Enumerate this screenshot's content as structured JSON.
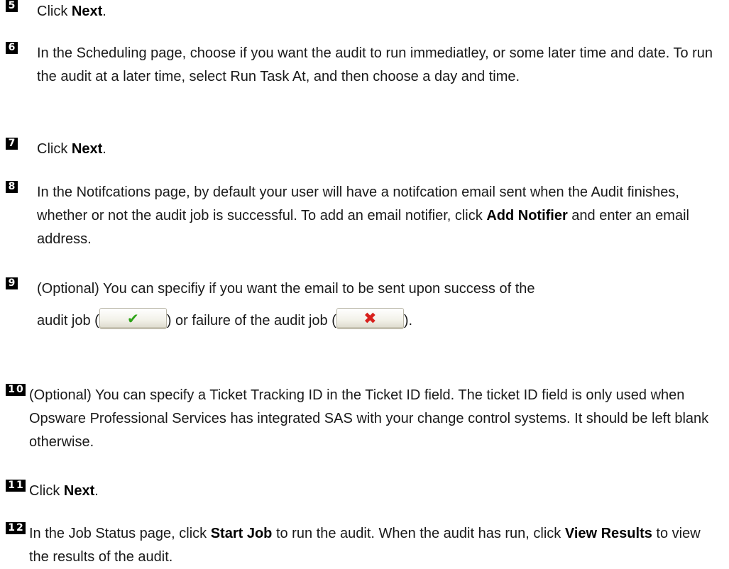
{
  "steps": [
    {
      "number": "5",
      "pre": "Click ",
      "bold": "Next",
      "post": "."
    },
    {
      "number": "6",
      "text": "In the Scheduling page, choose if you want the audit to run immediatley, or some later time and date. To run the audit at a later time, select Run Task At, and then choose a day and time."
    },
    {
      "number": "7",
      "pre": "Click ",
      "bold": "Next",
      "post": "."
    },
    {
      "number": "8",
      "pre": "In the Notifcations page, by default your user will have a notifcation email sent when the Audit finishes, whether or not the audit job is successful. To add an email notifier, click ",
      "bold": "Add Notifier",
      "post": " and enter an email address."
    },
    {
      "number": "9",
      "line1": "(Optional) You can specifiy if you want the email to be sent upon success of the",
      "line2_a": "audit job (",
      "line2_b": ") or failure of the audit job (",
      "line2_c": ").",
      "success_icon": "checkmark-icon",
      "failure_icon": "x-icon",
      "success_glyph": "✔",
      "failure_glyph": "✖"
    },
    {
      "number": "10",
      "text": "(Optional) You can specify a Ticket Tracking ID in the Ticket ID field. The ticket ID field is only used when Opsware Professional Services has integrated SAS with your change control systems. It should be left blank otherwise."
    },
    {
      "number": "11",
      "pre": "Click ",
      "bold": "Next",
      "post": "."
    },
    {
      "number": "12",
      "pre": "In the Job Status page, click ",
      "bold": "Start Job",
      "mid": " to run the audit. When the audit has run, click ",
      "bold2": "View Results",
      "post": " to view the results of the audit."
    }
  ]
}
